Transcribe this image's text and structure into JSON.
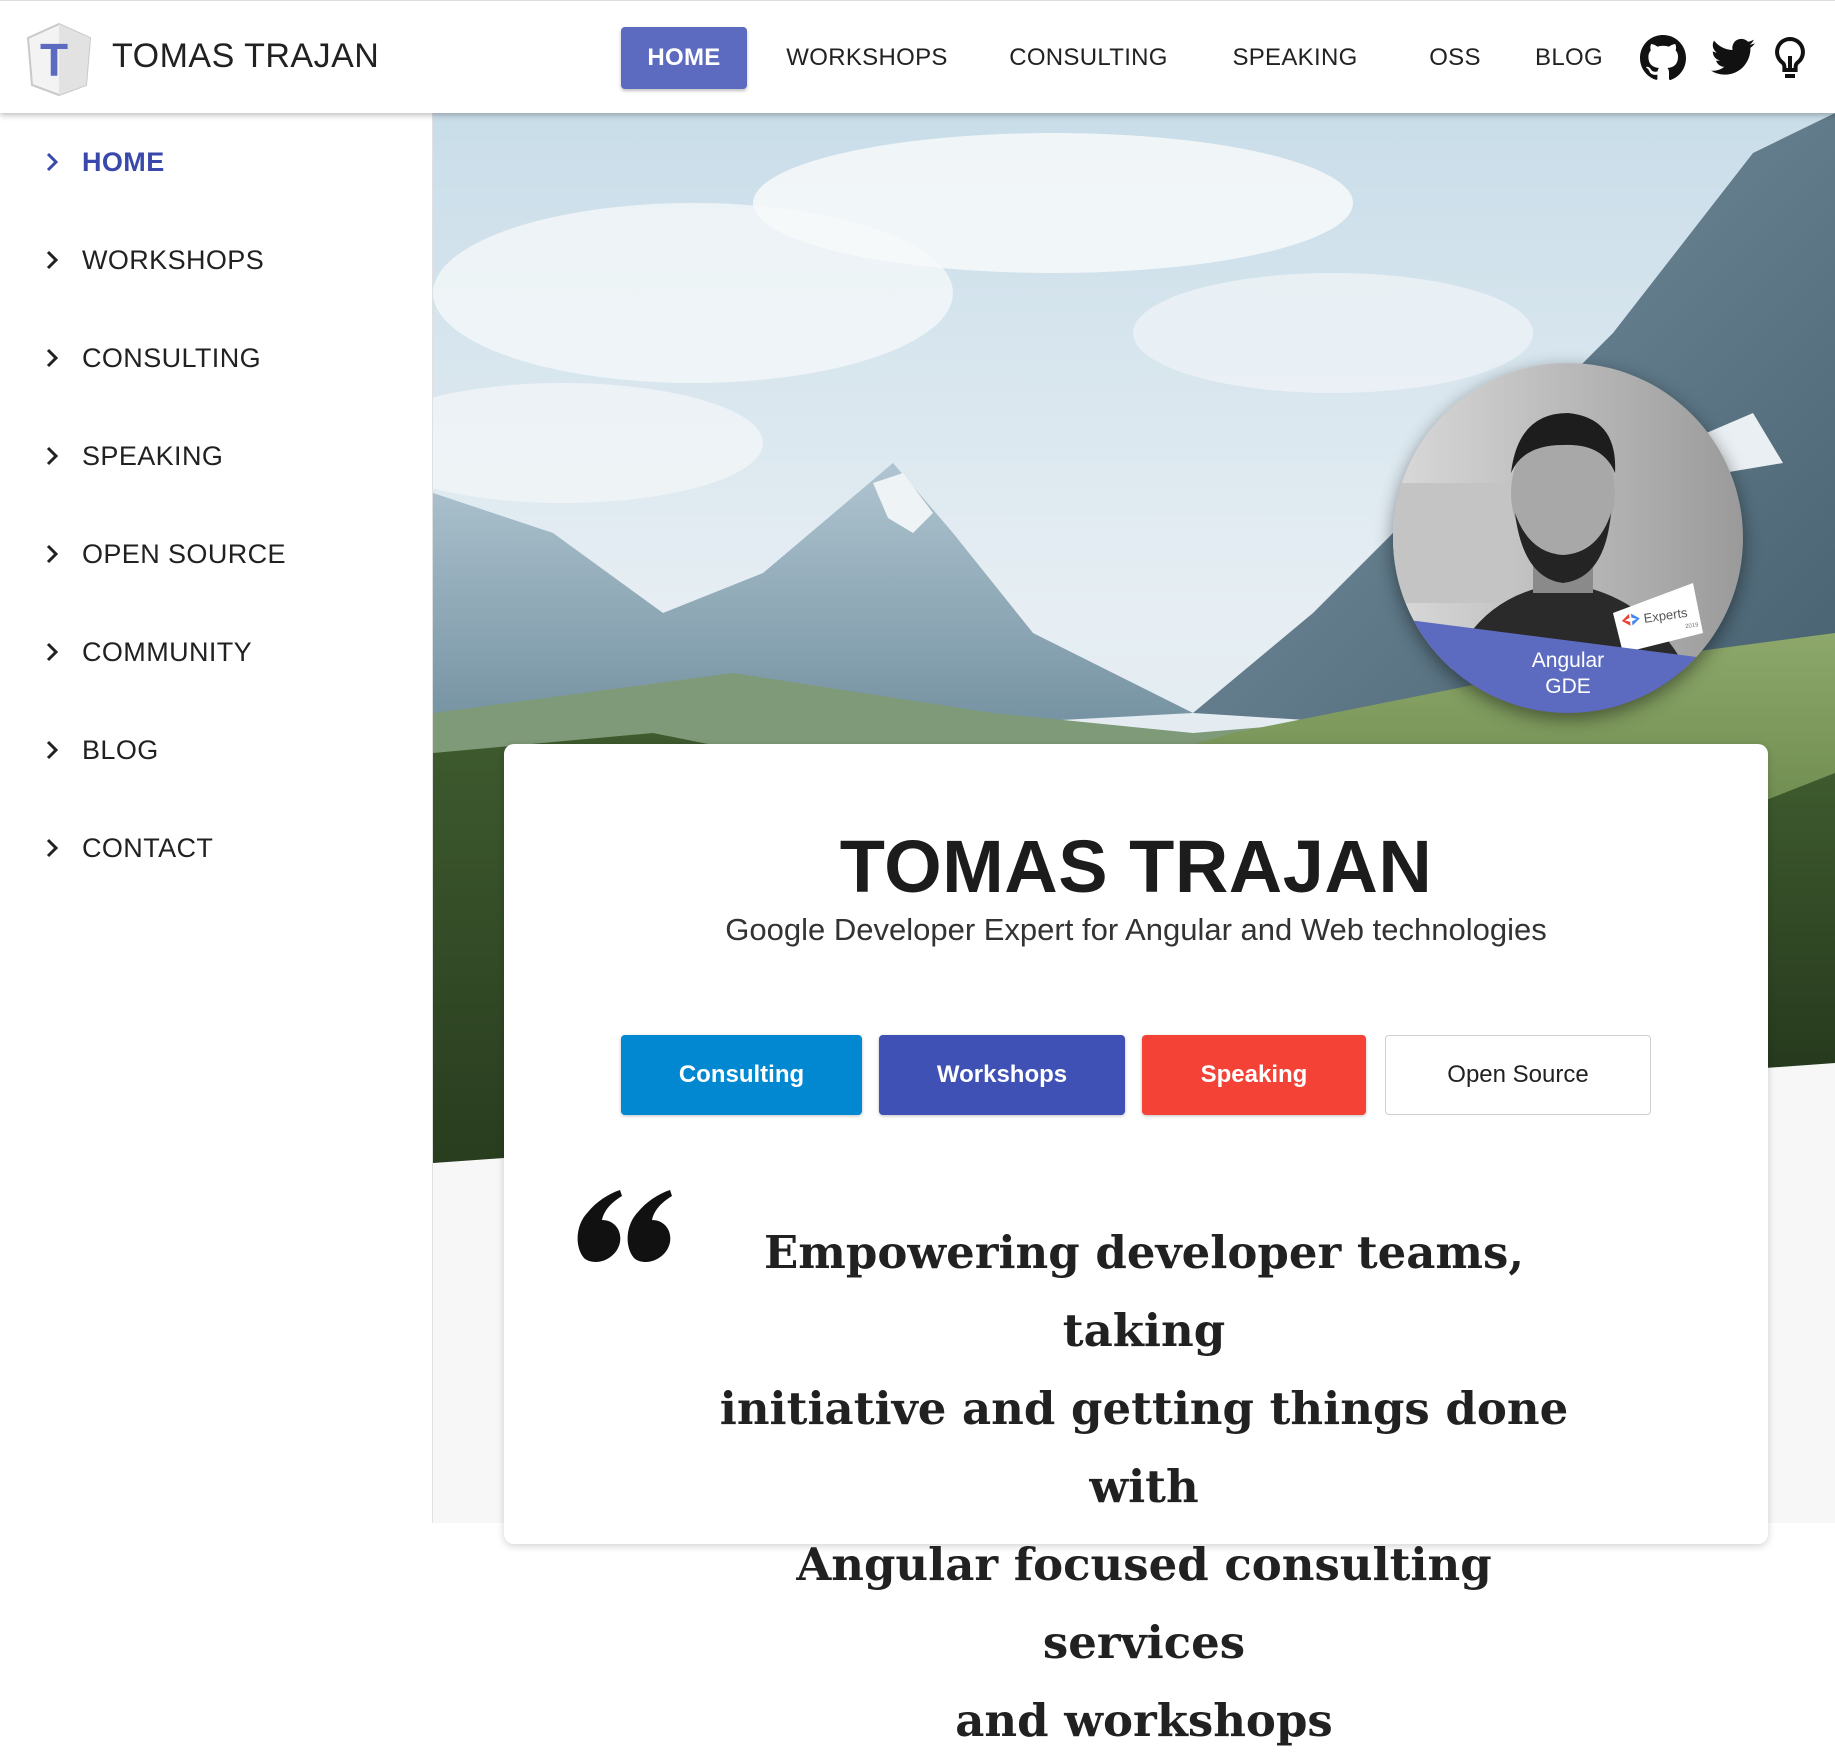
{
  "header": {
    "brand": "TOMAS TRAJAN",
    "logo_letter": "T",
    "nav": [
      {
        "label": "HOME",
        "active": true
      },
      {
        "label": "WORKSHOPS"
      },
      {
        "label": "CONSULTING"
      },
      {
        "label": "SPEAKING"
      },
      {
        "label": "OSS"
      },
      {
        "label": "BLOG"
      }
    ],
    "icons": [
      "github-icon",
      "twitter-icon",
      "lightbulb-icon"
    ]
  },
  "sidebar": {
    "items": [
      {
        "label": "HOME",
        "active": true
      },
      {
        "label": "WORKSHOPS"
      },
      {
        "label": "CONSULTING"
      },
      {
        "label": "SPEAKING"
      },
      {
        "label": "OPEN SOURCE"
      },
      {
        "label": "COMMUNITY"
      },
      {
        "label": "BLOG"
      },
      {
        "label": "CONTACT"
      }
    ]
  },
  "hero": {
    "avatar": {
      "badge_text": "Experts",
      "badge_year": "2019",
      "caption_line1": "Angular",
      "caption_line2": "GDE"
    },
    "title": "TOMAS TRAJAN",
    "subtitle": "Google Developer Expert for Angular and Web technologies",
    "buttons": [
      {
        "label": "Consulting",
        "color": "#0288d1"
      },
      {
        "label": "Workshops",
        "color": "#3f51b5"
      },
      {
        "label": "Speaking",
        "color": "#f44336"
      },
      {
        "label": "Open Source",
        "color": "#ffffff"
      }
    ],
    "quote_lines": [
      "Empowering developer teams, taking",
      "initiative and getting things done with",
      "Angular focused consulting services",
      "and workshops"
    ]
  },
  "colors": {
    "primary": "#5c6bc0",
    "sidebar_active": "#3949ab"
  }
}
